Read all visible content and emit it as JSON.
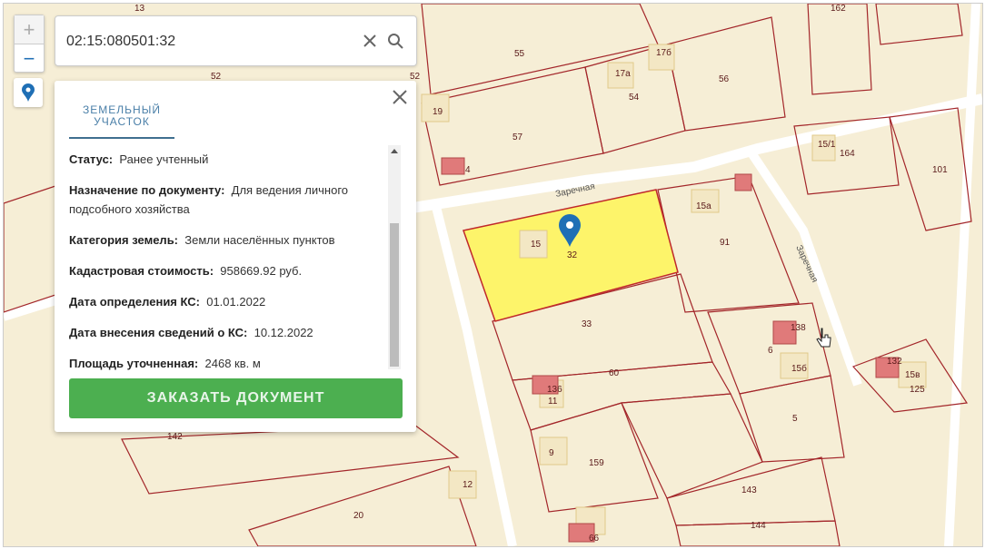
{
  "search": {
    "value": "02:15:080501:32"
  },
  "zoom": {
    "in_label": "+",
    "out_label": "−"
  },
  "panel": {
    "tab_label_line1": "ЗЕМЕЛЬНЫЙ",
    "tab_label_line2": "УЧАСТОК",
    "fields": [
      {
        "label": "Статус:",
        "value": "Ранее учтенный"
      },
      {
        "label": "Назначение по документу:",
        "value": "Для ведения личного подсобного хозяйства"
      },
      {
        "label": "Категория земель:",
        "value": "Земли населённых пунктов"
      },
      {
        "label": "Кадастровая стоимость:",
        "value": "958669.92 руб."
      },
      {
        "label": "Дата определения КС:",
        "value": "01.01.2022"
      },
      {
        "label": "Дата внесения сведений о КС:",
        "value": "10.12.2022"
      },
      {
        "label": "Площадь уточненная:",
        "value": "2468 кв. м"
      }
    ],
    "order_button": "ЗАКАЗАТЬ ДОКУМЕНТ"
  },
  "map": {
    "colors": {
      "background": "#f6eed6",
      "boundary": "#a3262a",
      "selected_fill": "#fdf46a",
      "building": "#e07a7a",
      "accent": "#1f6fb5"
    },
    "street_name": "Заречная",
    "labels": [
      "55",
      "52",
      "52",
      "17б",
      "17а",
      "56",
      "54",
      "19",
      "57",
      "4",
      "15/1",
      "164",
      "101",
      "15а",
      "91",
      "15",
      "32",
      "33",
      "138",
      "6",
      "15б",
      "132",
      "15в",
      "125",
      "60",
      "136",
      "11",
      "5",
      "9",
      "159",
      "142",
      "12",
      "143",
      "20",
      "144",
      "66",
      "162",
      "13"
    ]
  }
}
